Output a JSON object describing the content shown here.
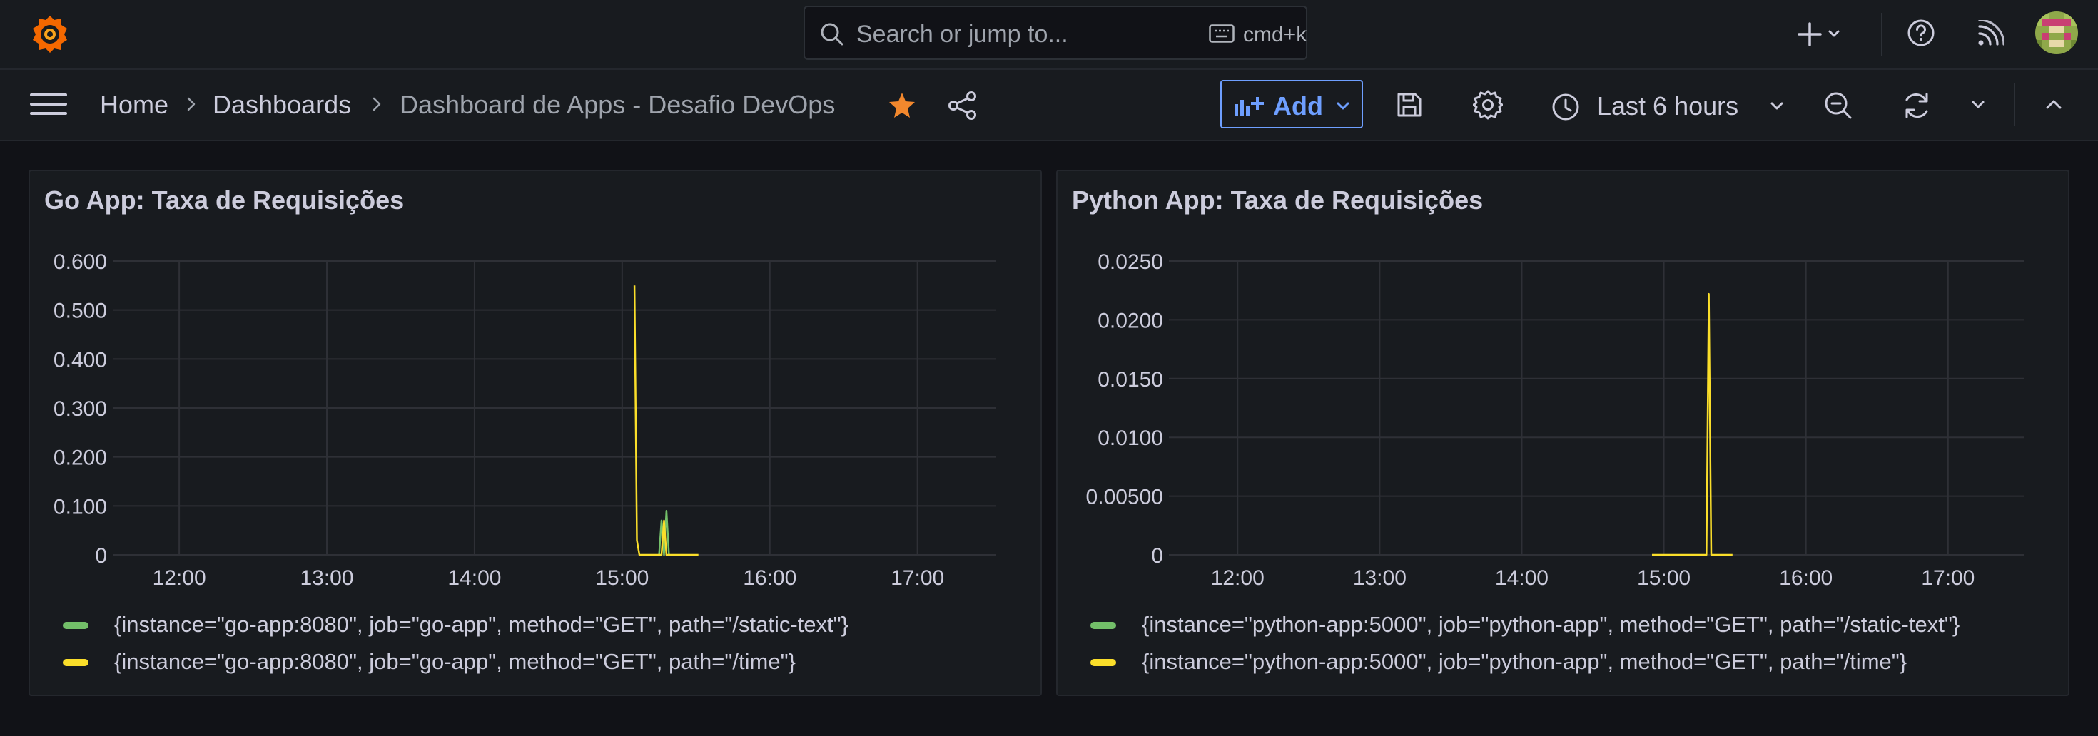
{
  "topbar": {
    "search_placeholder": "Search or jump to...",
    "search_shortcut": "cmd+k",
    "icons": [
      "grafana-logo-icon",
      "search-icon",
      "keyboard-icon",
      "plus-icon",
      "help-icon",
      "news-rss-icon",
      "user-avatar"
    ]
  },
  "navbar": {
    "breadcrumbs": [
      "Home",
      "Dashboards",
      "Dashboard de Apps - Desafio DevOps"
    ],
    "add_label": "Add",
    "time_range": "Last 6 hours",
    "starred": true
  },
  "colors": {
    "background": "#111217",
    "panel": "#181b1f",
    "accent_blue": "#6e9fff",
    "star": "#f2882d",
    "series_green": "#73bf69",
    "series_yellow": "#fade2a"
  },
  "panels": [
    {
      "title": "Go App: Taxa de Requisições",
      "legend": [
        {
          "label": "{instance=\"go-app:8080\", job=\"go-app\", method=\"GET\", path=\"/static-text\"}",
          "color": "#73bf69"
        },
        {
          "label": "{instance=\"go-app:8080\", job=\"go-app\", method=\"GET\", path=\"/time\"}",
          "color": "#fade2a"
        }
      ]
    },
    {
      "title": "Python App: Taxa de Requisições",
      "legend": [
        {
          "label": "{instance=\"python-app:5000\", job=\"python-app\", method=\"GET\", path=\"/static-text\"}",
          "color": "#73bf69"
        },
        {
          "label": "{instance=\"python-app:5000\", job=\"python-app\", method=\"GET\", path=\"/time\"}",
          "color": "#fade2a"
        }
      ]
    }
  ],
  "chart_data": [
    {
      "type": "line",
      "title": "Go App: Taxa de Requisições",
      "x_ticks": [
        "12:00",
        "13:00",
        "14:00",
        "15:00",
        "16:00",
        "17:00"
      ],
      "y_ticks": [
        "0",
        "0.100",
        "0.200",
        "0.300",
        "0.400",
        "0.500",
        "0.600"
      ],
      "xlim": [
        "11:33",
        "17:32"
      ],
      "ylim": [
        0,
        0.6
      ],
      "grid": true,
      "legend_position": "bottom",
      "series": [
        {
          "name": "{instance=\"go-app:8080\", job=\"go-app\", method=\"GET\", path=\"/static-text\"}",
          "color": "#73bf69",
          "points": [
            [
              "15:15",
              0
            ],
            [
              "15:16",
              0.07
            ],
            [
              "15:17",
              0
            ],
            [
              "15:18",
              0.09
            ],
            [
              "15:19",
              0
            ]
          ]
        },
        {
          "name": "{instance=\"go-app:8080\", job=\"go-app\", method=\"GET\", path=\"/time\"}",
          "color": "#fade2a",
          "points": [
            [
              "15:05",
              0.55
            ],
            [
              "15:06",
              0.03
            ],
            [
              "15:07",
              0
            ],
            [
              "15:12",
              0
            ],
            [
              "15:13",
              0
            ],
            [
              "15:16",
              0
            ],
            [
              "15:17",
              0.07
            ],
            [
              "15:18",
              0
            ],
            [
              "15:21",
              0
            ],
            [
              "15:28",
              0
            ],
            [
              "15:31",
              0
            ]
          ]
        }
      ]
    },
    {
      "type": "line",
      "title": "Python App: Taxa de Requisições",
      "x_ticks": [
        "12:00",
        "13:00",
        "14:00",
        "15:00",
        "16:00",
        "17:00"
      ],
      "y_ticks": [
        "0",
        "0.00500",
        "0.0100",
        "0.0150",
        "0.0200",
        "0.0250"
      ],
      "xlim": [
        "11:31",
        "17:32"
      ],
      "ylim": [
        0,
        0.025
      ],
      "grid": true,
      "legend_position": "bottom",
      "series": [
        {
          "name": "{instance=\"python-app:5000\", job=\"python-app\", method=\"GET\", path=\"/static-text\"}",
          "color": "#73bf69",
          "points": []
        },
        {
          "name": "{instance=\"python-app:5000\", job=\"python-app\", method=\"GET\", path=\"/time\"}",
          "color": "#fade2a",
          "points": [
            [
              "14:55",
              0
            ],
            [
              "14:56",
              0
            ],
            [
              "15:07",
              0
            ],
            [
              "15:13",
              0
            ],
            [
              "15:18",
              0
            ],
            [
              "15:19",
              0.0222
            ],
            [
              "15:20",
              0
            ],
            [
              "15:21",
              0
            ],
            [
              "15:27",
              0
            ],
            [
              "15:29",
              0
            ]
          ]
        }
      ]
    }
  ]
}
